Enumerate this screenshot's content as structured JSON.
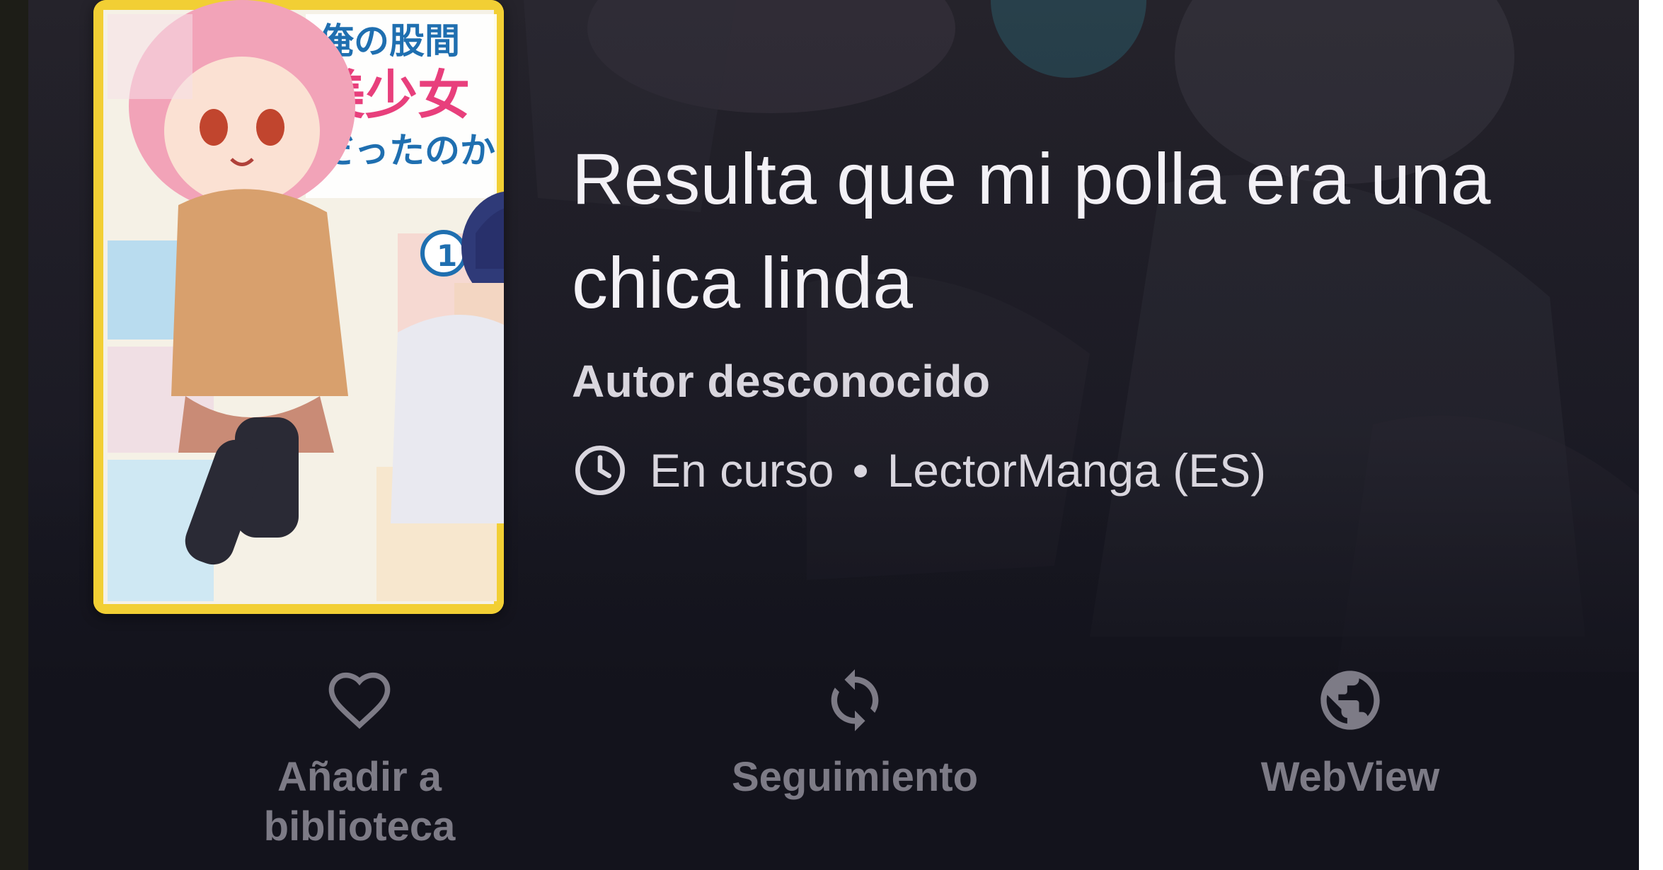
{
  "manga": {
    "title": "Resulta que mi polla era una chica linda",
    "author": "Autor desconocido",
    "status": "En curso",
    "separator": "•",
    "source": "LectorManga (ES)"
  },
  "cover": {
    "title_jp": "俺の股間が美少女だったのか",
    "volume": "1"
  },
  "actions": {
    "library_line1": "Añadir a",
    "library_line2": "biblioteca",
    "tracking": "Seguimiento",
    "webview": "WebView"
  },
  "icons": {
    "library": "heart-outline-icon",
    "tracking": "sync-icon",
    "webview": "globe-icon",
    "status": "clock-icon"
  },
  "colors": {
    "background": "#1d1c26",
    "title_text": "#f3f1f6",
    "secondary_text": "#d9d6de",
    "action_text": "#7d7b86",
    "cover_border": "#f2cf34"
  }
}
